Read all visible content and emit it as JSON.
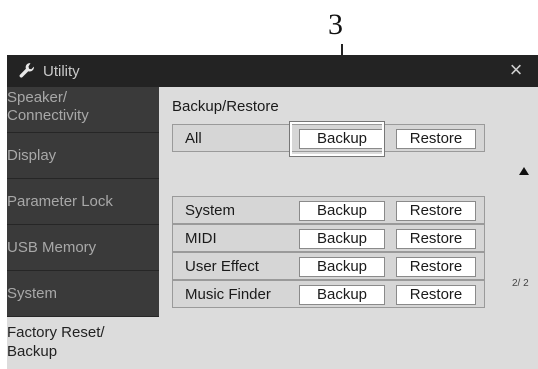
{
  "callout": {
    "number": "3"
  },
  "window": {
    "title": "Utility",
    "close_glyph": "×",
    "icon": "wrench-icon"
  },
  "sidebar": {
    "items": [
      {
        "label_lines": [
          "Speaker/",
          "Connectivity"
        ],
        "active": false
      },
      {
        "label_lines": [
          "Display"
        ],
        "active": false
      },
      {
        "label_lines": [
          "Parameter Lock"
        ],
        "active": false
      },
      {
        "label_lines": [
          "USB Memory"
        ],
        "active": false
      },
      {
        "label_lines": [
          "System"
        ],
        "active": false
      },
      {
        "label_lines": [
          "Factory Reset/",
          "Backup"
        ],
        "active": true
      }
    ]
  },
  "main": {
    "section_title": "Backup/Restore",
    "rows": [
      {
        "label": "All",
        "backup": "Backup",
        "restore": "Restore"
      },
      {
        "label": "System",
        "backup": "Backup",
        "restore": "Restore"
      },
      {
        "label": "MIDI",
        "backup": "Backup",
        "restore": "Restore"
      },
      {
        "label": "User Effect",
        "backup": "Backup",
        "restore": "Restore"
      },
      {
        "label": "Music Finder",
        "backup": "Backup",
        "restore": "Restore"
      }
    ],
    "page_indicator": "2/ 2",
    "scroll_icon": "scroll-up-icon"
  }
}
